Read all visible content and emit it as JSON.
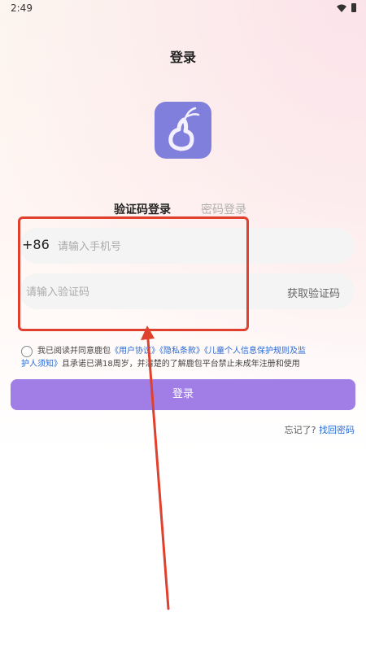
{
  "status_bar": {
    "time": "2:49"
  },
  "header": {
    "title": "登录"
  },
  "tabs": [
    {
      "label": "验证码登录",
      "active": true
    },
    {
      "label": "密码登录",
      "active": false
    }
  ],
  "phone": {
    "country_code": "+86",
    "placeholder": "请输入手机号",
    "value": ""
  },
  "code": {
    "placeholder": "请输入验证码",
    "value": "",
    "get_code_label": "获取验证码"
  },
  "agreement": {
    "checked": false,
    "prefix": "我已阅读并同意鹿包",
    "link1": "《用户协议》",
    "link2": "《隐私条款》",
    "link3a": "《儿童个人信息保护规则及监",
    "link3b": "护人须知》",
    "suffix": "且承诺已满18周岁，并清楚的了解鹿包平台禁止未成年注册和使用"
  },
  "login_button": {
    "label": "登录"
  },
  "forgot": {
    "prefix": "忘记了?",
    "link": "找回密码"
  },
  "colors": {
    "accent": "#a07ee6",
    "logo": "#8080dc",
    "link": "#2a6ad4",
    "annotation": "#e0412f"
  },
  "icons": [
    "wifi-icon",
    "battery-icon",
    "deer-logo-icon",
    "radio-circle-icon"
  ]
}
